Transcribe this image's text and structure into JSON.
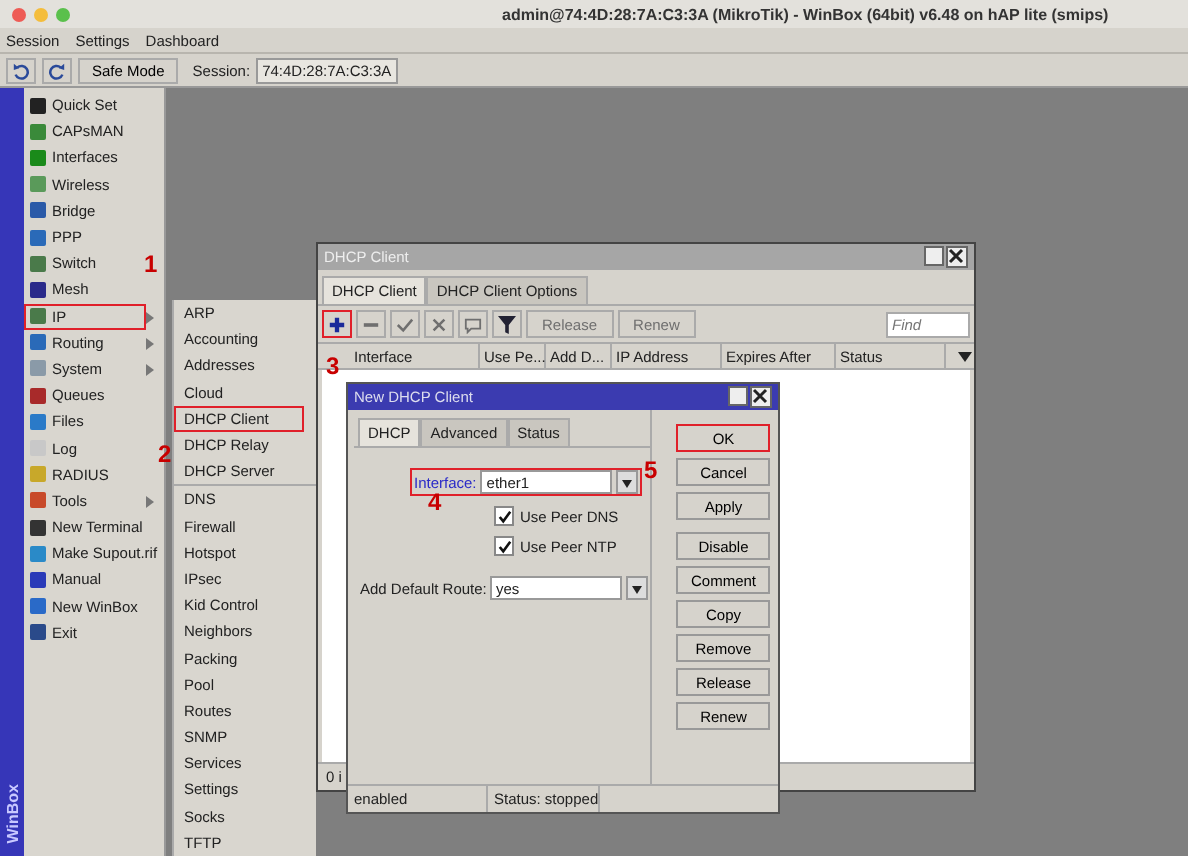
{
  "window": {
    "title": "admin@74:4D:28:7A:C3:3A (MikroTik) - WinBox (64bit) v6.48 on hAP lite (smips)"
  },
  "menu_bar": [
    "Session",
    "Settings",
    "Dashboard"
  ],
  "toolbar": {
    "safe_mode": "Safe Mode",
    "session_label": "Session:",
    "session_value": "74:4D:28:7A:C3:3A"
  },
  "side_label": "WinBox",
  "sidebar": {
    "items": [
      {
        "label": "Quick Set",
        "submenu": false,
        "marked": false
      },
      {
        "label": "CAPsMAN",
        "submenu": false,
        "marked": false
      },
      {
        "label": "Interfaces",
        "submenu": false,
        "marked": false
      },
      {
        "label": "Wireless",
        "submenu": false,
        "marked": false
      },
      {
        "label": "Bridge",
        "submenu": false,
        "marked": false
      },
      {
        "label": "PPP",
        "submenu": false,
        "marked": false
      },
      {
        "label": "Switch",
        "submenu": false,
        "marked": false
      },
      {
        "label": "Mesh",
        "submenu": false,
        "marked": false
      },
      {
        "label": "IP",
        "submenu": true,
        "marked": true
      },
      {
        "label": "Routing",
        "submenu": true,
        "marked": false
      },
      {
        "label": "System",
        "submenu": true,
        "marked": false
      },
      {
        "label": "Queues",
        "submenu": false,
        "marked": false
      },
      {
        "label": "Files",
        "submenu": false,
        "marked": false
      },
      {
        "label": "Log",
        "submenu": false,
        "marked": false
      },
      {
        "label": "RADIUS",
        "submenu": false,
        "marked": false
      },
      {
        "label": "Tools",
        "submenu": true,
        "marked": false
      },
      {
        "label": "New Terminal",
        "submenu": false,
        "marked": false
      },
      {
        "label": "Make Supout.rif",
        "submenu": false,
        "marked": false
      },
      {
        "label": "Manual",
        "submenu": false,
        "marked": false
      },
      {
        "label": "New WinBox",
        "submenu": false,
        "marked": false
      },
      {
        "label": "Exit",
        "submenu": false,
        "marked": false
      }
    ]
  },
  "submenu": {
    "items": [
      {
        "label": "ARP",
        "divider_above": false,
        "marked": false
      },
      {
        "label": "Accounting",
        "divider_above": false,
        "marked": false
      },
      {
        "label": "Addresses",
        "divider_above": false,
        "marked": false
      },
      {
        "label": "Cloud",
        "divider_above": false,
        "marked": false
      },
      {
        "label": "DHCP Client",
        "divider_above": false,
        "marked": true
      },
      {
        "label": "DHCP Relay",
        "divider_above": false,
        "marked": false
      },
      {
        "label": "DHCP Server",
        "divider_above": false,
        "marked": false
      },
      {
        "label": "DNS",
        "divider_above": true,
        "marked": false
      },
      {
        "label": "Firewall",
        "divider_above": false,
        "marked": false
      },
      {
        "label": "Hotspot",
        "divider_above": false,
        "marked": false
      },
      {
        "label": "IPsec",
        "divider_above": false,
        "marked": false
      },
      {
        "label": "Kid Control",
        "divider_above": false,
        "marked": false
      },
      {
        "label": "Neighbors",
        "divider_above": false,
        "marked": false
      },
      {
        "label": "Packing",
        "divider_above": false,
        "marked": false
      },
      {
        "label": "Pool",
        "divider_above": false,
        "marked": false
      },
      {
        "label": "Routes",
        "divider_above": false,
        "marked": false
      },
      {
        "label": "SNMP",
        "divider_above": false,
        "marked": false
      },
      {
        "label": "Services",
        "divider_above": false,
        "marked": false
      },
      {
        "label": "Settings",
        "divider_above": false,
        "marked": false
      },
      {
        "label": "Socks",
        "divider_above": false,
        "marked": false
      },
      {
        "label": "TFTP",
        "divider_above": false,
        "marked": false
      }
    ]
  },
  "dhcp_window": {
    "title": "DHCP Client",
    "tabs": [
      {
        "label": "DHCP Client",
        "selected": true
      },
      {
        "label": "DHCP Client Options",
        "selected": false
      }
    ],
    "toolbar": [
      {
        "kind": "add",
        "disabled": false,
        "marked": true
      },
      {
        "kind": "remove",
        "disabled": true,
        "marked": false
      },
      {
        "kind": "enable",
        "disabled": true,
        "marked": false
      },
      {
        "kind": "disable",
        "disabled": true,
        "marked": false
      },
      {
        "kind": "comment",
        "disabled": true,
        "marked": false
      },
      {
        "kind": "filter",
        "disabled": false,
        "marked": false
      },
      {
        "kind": "text",
        "label": "Release",
        "disabled": true,
        "marked": false
      },
      {
        "kind": "text",
        "label": "Renew",
        "disabled": true,
        "marked": false
      }
    ],
    "search": {
      "placeholder": "Find"
    },
    "columns": [
      "Interface",
      "Use Pe...",
      "Add D...",
      "IP Address",
      "Expires After",
      "Status"
    ],
    "status_bar": "0 i"
  },
  "dialog": {
    "title": "New DHCP Client",
    "tabs": [
      {
        "label": "DHCP",
        "selected": true
      },
      {
        "label": "Advanced",
        "selected": false
      },
      {
        "label": "Status",
        "selected": false
      }
    ],
    "interface": {
      "label": "Interface:",
      "value": "ether1",
      "marked": true
    },
    "checkboxes": [
      {
        "label": "Use Peer DNS",
        "checked": true
      },
      {
        "label": "Use Peer NTP",
        "checked": true
      }
    ],
    "default_route": {
      "label": "Add Default Route:",
      "value": "yes"
    },
    "buttons": [
      {
        "label": "OK",
        "marked": true
      },
      {
        "label": "Cancel",
        "marked": false
      },
      {
        "label": "Apply",
        "marked": false
      },
      {
        "label": "Disable",
        "marked": false
      },
      {
        "label": "Comment",
        "marked": false
      },
      {
        "label": "Copy",
        "marked": false
      },
      {
        "label": "Remove",
        "marked": false
      },
      {
        "label": "Release",
        "marked": false
      },
      {
        "label": "Renew",
        "marked": false
      }
    ],
    "status_bar": [
      "enabled",
      "Status: stopped"
    ]
  },
  "annotations": [
    "1",
    "2",
    "3",
    "4",
    "5"
  ]
}
